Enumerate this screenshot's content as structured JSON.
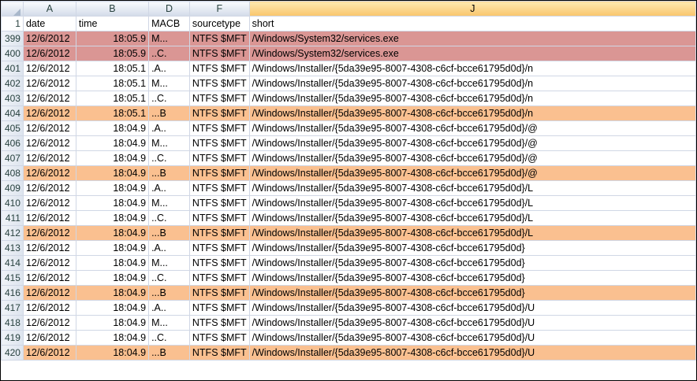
{
  "columns": [
    "A",
    "B",
    "D",
    "F",
    "J"
  ],
  "header_row": {
    "num": "1",
    "date": "date",
    "time": "time",
    "macb": "MACB",
    "sourcetype": "sourcetype",
    "short": "short"
  },
  "rows": [
    {
      "num": "399",
      "date": "12/6/2012",
      "time": "18:05.9",
      "macb": "M...",
      "sourcetype": "NTFS $MFT",
      "short": "/Windows/System32/services.exe",
      "hl": "red"
    },
    {
      "num": "400",
      "date": "12/6/2012",
      "time": "18:05.9",
      "macb": "..C.",
      "sourcetype": "NTFS $MFT",
      "short": "/Windows/System32/services.exe",
      "hl": "red"
    },
    {
      "num": "401",
      "date": "12/6/2012",
      "time": "18:05.1",
      "macb": ".A..",
      "sourcetype": "NTFS $MFT",
      "short": "/Windows/Installer/{5da39e95-8007-4308-c6cf-bcce61795d0d}/n",
      "hl": ""
    },
    {
      "num": "402",
      "date": "12/6/2012",
      "time": "18:05.1",
      "macb": "M...",
      "sourcetype": "NTFS $MFT",
      "short": "/Windows/Installer/{5da39e95-8007-4308-c6cf-bcce61795d0d}/n",
      "hl": ""
    },
    {
      "num": "403",
      "date": "12/6/2012",
      "time": "18:05.1",
      "macb": "..C.",
      "sourcetype": "NTFS $MFT",
      "short": "/Windows/Installer/{5da39e95-8007-4308-c6cf-bcce61795d0d}/n",
      "hl": ""
    },
    {
      "num": "404",
      "date": "12/6/2012",
      "time": "18:05.1",
      "macb": "...B",
      "sourcetype": "NTFS $MFT",
      "short": "/Windows/Installer/{5da39e95-8007-4308-c6cf-bcce61795d0d}/n",
      "hl": "orange"
    },
    {
      "num": "405",
      "date": "12/6/2012",
      "time": "18:04.9",
      "macb": ".A..",
      "sourcetype": "NTFS $MFT",
      "short": "/Windows/Installer/{5da39e95-8007-4308-c6cf-bcce61795d0d}/@",
      "hl": ""
    },
    {
      "num": "406",
      "date": "12/6/2012",
      "time": "18:04.9",
      "macb": "M...",
      "sourcetype": "NTFS $MFT",
      "short": "/Windows/Installer/{5da39e95-8007-4308-c6cf-bcce61795d0d}/@",
      "hl": ""
    },
    {
      "num": "407",
      "date": "12/6/2012",
      "time": "18:04.9",
      "macb": "..C.",
      "sourcetype": "NTFS $MFT",
      "short": "/Windows/Installer/{5da39e95-8007-4308-c6cf-bcce61795d0d}/@",
      "hl": ""
    },
    {
      "num": "408",
      "date": "12/6/2012",
      "time": "18:04.9",
      "macb": "...B",
      "sourcetype": "NTFS $MFT",
      "short": "/Windows/Installer/{5da39e95-8007-4308-c6cf-bcce61795d0d}/@",
      "hl": "orange"
    },
    {
      "num": "409",
      "date": "12/6/2012",
      "time": "18:04.9",
      "macb": ".A..",
      "sourcetype": "NTFS $MFT",
      "short": "/Windows/Installer/{5da39e95-8007-4308-c6cf-bcce61795d0d}/L",
      "hl": ""
    },
    {
      "num": "410",
      "date": "12/6/2012",
      "time": "18:04.9",
      "macb": "M...",
      "sourcetype": "NTFS $MFT",
      "short": "/Windows/Installer/{5da39e95-8007-4308-c6cf-bcce61795d0d}/L",
      "hl": ""
    },
    {
      "num": "411",
      "date": "12/6/2012",
      "time": "18:04.9",
      "macb": "..C.",
      "sourcetype": "NTFS $MFT",
      "short": "/Windows/Installer/{5da39e95-8007-4308-c6cf-bcce61795d0d}/L",
      "hl": ""
    },
    {
      "num": "412",
      "date": "12/6/2012",
      "time": "18:04.9",
      "macb": "...B",
      "sourcetype": "NTFS $MFT",
      "short": "/Windows/Installer/{5da39e95-8007-4308-c6cf-bcce61795d0d}/L",
      "hl": "orange"
    },
    {
      "num": "413",
      "date": "12/6/2012",
      "time": "18:04.9",
      "macb": ".A..",
      "sourcetype": "NTFS $MFT",
      "short": "/Windows/Installer/{5da39e95-8007-4308-c6cf-bcce61795d0d}",
      "hl": ""
    },
    {
      "num": "414",
      "date": "12/6/2012",
      "time": "18:04.9",
      "macb": "M...",
      "sourcetype": "NTFS $MFT",
      "short": "/Windows/Installer/{5da39e95-8007-4308-c6cf-bcce61795d0d}",
      "hl": ""
    },
    {
      "num": "415",
      "date": "12/6/2012",
      "time": "18:04.9",
      "macb": "..C.",
      "sourcetype": "NTFS $MFT",
      "short": "/Windows/Installer/{5da39e95-8007-4308-c6cf-bcce61795d0d}",
      "hl": ""
    },
    {
      "num": "416",
      "date": "12/6/2012",
      "time": "18:04.9",
      "macb": "...B",
      "sourcetype": "NTFS $MFT",
      "short": "/Windows/Installer/{5da39e95-8007-4308-c6cf-bcce61795d0d}",
      "hl": "orange"
    },
    {
      "num": "417",
      "date": "12/6/2012",
      "time": "18:04.9",
      "macb": ".A..",
      "sourcetype": "NTFS $MFT",
      "short": "/Windows/Installer/{5da39e95-8007-4308-c6cf-bcce61795d0d}/U",
      "hl": ""
    },
    {
      "num": "418",
      "date": "12/6/2012",
      "time": "18:04.9",
      "macb": "M...",
      "sourcetype": "NTFS $MFT",
      "short": "/Windows/Installer/{5da39e95-8007-4308-c6cf-bcce61795d0d}/U",
      "hl": ""
    },
    {
      "num": "419",
      "date": "12/6/2012",
      "time": "18:04.9",
      "macb": "..C.",
      "sourcetype": "NTFS $MFT",
      "short": "/Windows/Installer/{5da39e95-8007-4308-c6cf-bcce61795d0d}/U",
      "hl": ""
    },
    {
      "num": "420",
      "date": "12/6/2012",
      "time": "18:04.9",
      "macb": "...B",
      "sourcetype": "NTFS $MFT",
      "short": "/Windows/Installer/{5da39e95-8007-4308-c6cf-bcce61795d0d}/U",
      "hl": "orange"
    }
  ],
  "colors": {
    "red_highlight": "#da9694",
    "orange_highlight": "#fac090",
    "selected_header": "#f9c56c"
  }
}
